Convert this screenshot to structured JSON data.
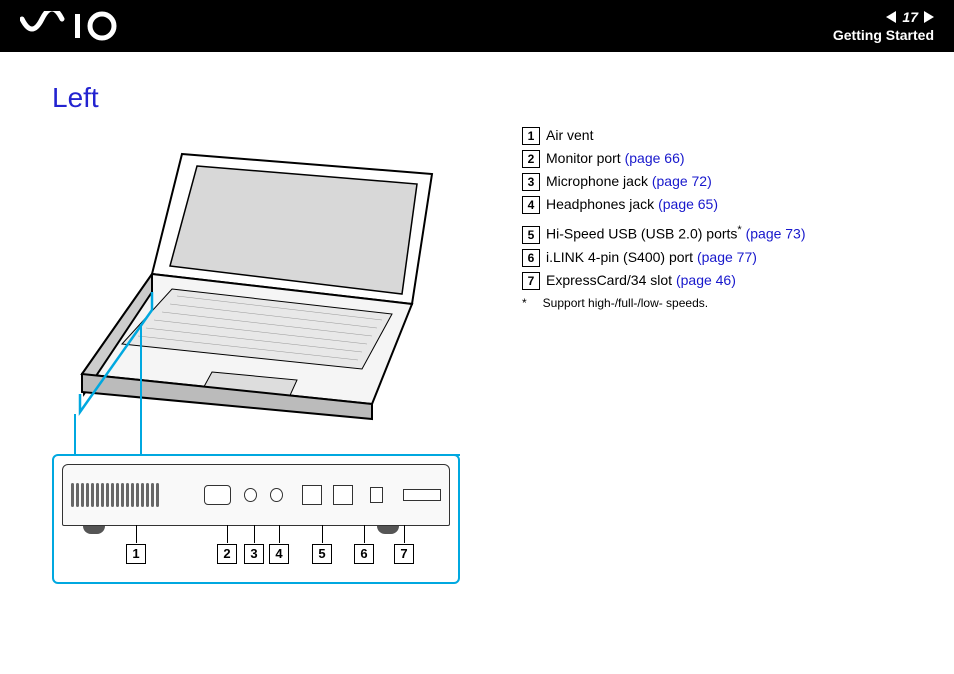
{
  "header": {
    "logo_text": "VAIO",
    "page_number": "17",
    "section": "Getting Started"
  },
  "title": "Left",
  "items": [
    {
      "num": "1",
      "label": "Air vent",
      "link": ""
    },
    {
      "num": "2",
      "label": "Monitor port",
      "link": "(page 66)"
    },
    {
      "num": "3",
      "label": "Microphone jack",
      "link": "(page 72)"
    },
    {
      "num": "4",
      "label": "Headphones jack",
      "link": "(page 65)"
    },
    {
      "num": "5",
      "label": "Hi-Speed USB (USB 2.0) ports",
      "asterisk": "*",
      "link": "(page 73)"
    },
    {
      "num": "6",
      "label": "i.LINK 4-pin (S400) port",
      "link": "(page 77)"
    },
    {
      "num": "7",
      "label": "ExpressCard/34 slot",
      "link": "(page 46)"
    }
  ],
  "footnote": {
    "mark": "*",
    "text": "Support high-/full-/low- speeds."
  },
  "diagram_nums": [
    "1",
    "2",
    "3",
    "4",
    "5",
    "6",
    "7"
  ]
}
